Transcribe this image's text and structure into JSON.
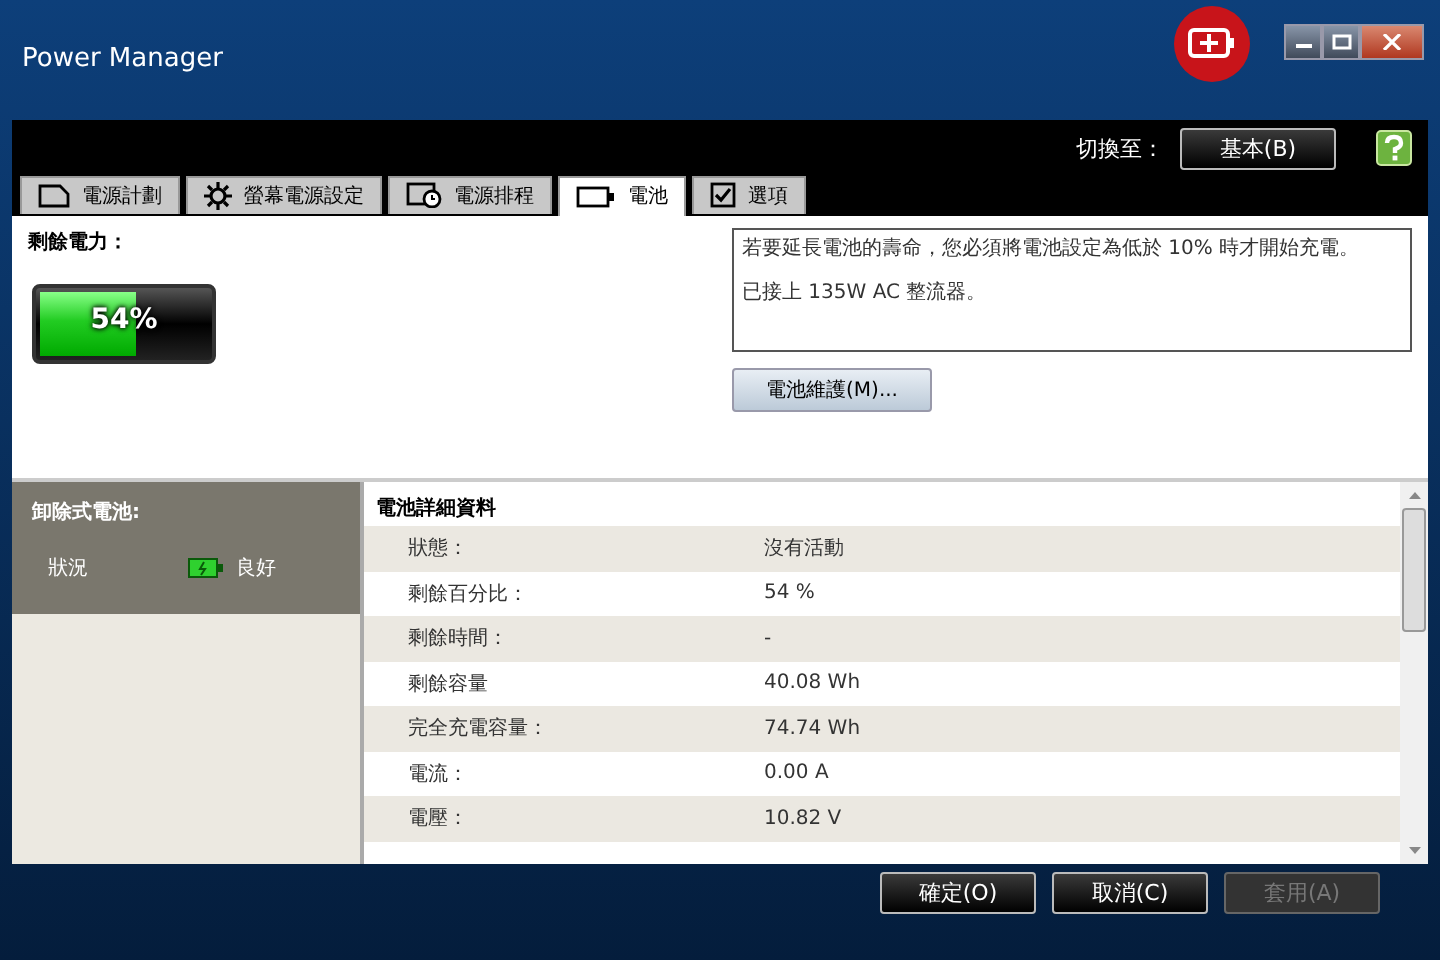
{
  "window": {
    "title": "Power Manager"
  },
  "header": {
    "switch_label": "切換至：",
    "mode_button": "基本(B)"
  },
  "tabs": [
    {
      "label": "電源計劃",
      "kind": "plan",
      "selected": false
    },
    {
      "label": "螢幕電源設定",
      "kind": "display",
      "selected": false
    },
    {
      "label": "電源排程",
      "kind": "schedule",
      "selected": false
    },
    {
      "label": "電池",
      "kind": "battery",
      "selected": true
    },
    {
      "label": "選項",
      "kind": "options",
      "selected": false
    }
  ],
  "battery": {
    "label": "剩餘電力：",
    "level": 0.54,
    "reading": "54%"
  },
  "info": {
    "lines": [
      "若要延長電池的壽命，您必須將電池設定為低於 10% 時才開始充電。",
      "已接上 135W AC 整流器。"
    ],
    "maintenance_button": "電池維護(M)..."
  },
  "removable": {
    "title": "卸除式電池:",
    "status_label": "狀況",
    "status_value": "良好"
  },
  "details": {
    "title": "電池詳細資料",
    "rows": [
      {
        "label": "狀態：",
        "value": "沒有活動"
      },
      {
        "label": "剩餘百分比：",
        "value": "54 %"
      },
      {
        "label": "剩餘時間：",
        "value": "-"
      },
      {
        "label": "剩餘容量",
        "value": "40.08 Wh"
      },
      {
        "label": "完全充電容量：",
        "value": "74.74 Wh"
      },
      {
        "label": "電流：",
        "value": "0.00 A"
      },
      {
        "label": "電壓：",
        "value": "10.82 V"
      }
    ]
  },
  "buttons": [
    {
      "label": "確定(O)",
      "disabled": false
    },
    {
      "label": "取消(C)",
      "disabled": false
    },
    {
      "label": "套用(A)",
      "disabled": true
    }
  ]
}
